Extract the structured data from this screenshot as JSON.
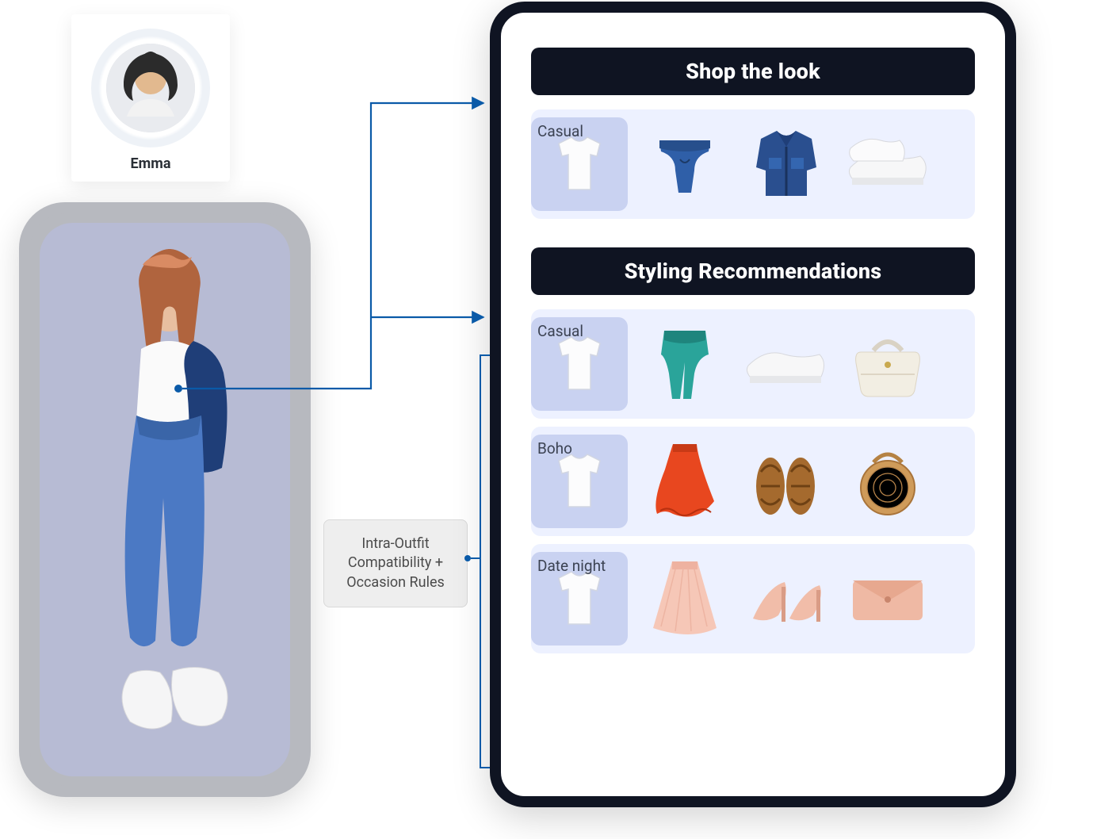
{
  "avatar": {
    "name": "Emma"
  },
  "rules_box": {
    "text": "Intra-Outfit Compatibility + Occasion Rules"
  },
  "panels": {
    "shop_the_look": {
      "title": "Shop the look",
      "rows": [
        {
          "tag": "Casual",
          "items": [
            "tshirt",
            "jeans",
            "denim-jacket",
            "white-sneakers"
          ]
        }
      ]
    },
    "styling_recommendations": {
      "title": "Styling Recommendations",
      "rows": [
        {
          "tag": "Casual",
          "items": [
            "tshirt",
            "teal-jeans",
            "white-sneakers",
            "white-bag"
          ]
        },
        {
          "tag": "Boho",
          "items": [
            "tshirt",
            "orange-skirt",
            "sandals",
            "round-bag"
          ]
        },
        {
          "tag": "Date night",
          "items": [
            "tshirt",
            "pink-skirt",
            "pink-heels",
            "pink-clutch"
          ]
        }
      ]
    }
  }
}
